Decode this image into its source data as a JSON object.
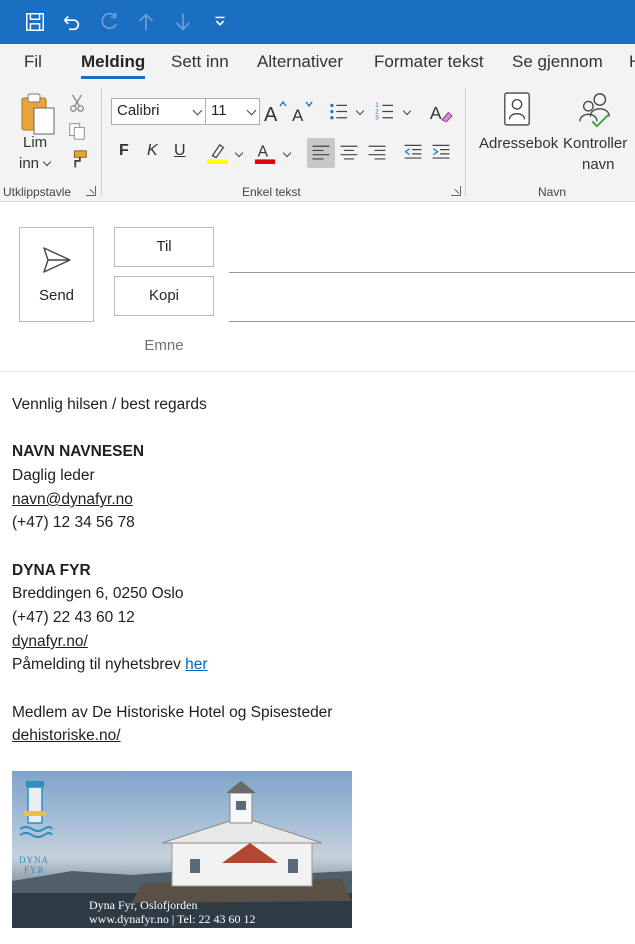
{
  "ribbon_tabs": [
    "Fil",
    "Melding",
    "Sett inn",
    "Alternativer",
    "Formater tekst",
    "Se gjennom",
    "H"
  ],
  "clipboard": {
    "paste_label_1": "Lim",
    "paste_label_2": "inn",
    "group_label": "Utklippstavle"
  },
  "basic_text": {
    "font_name": "Calibri",
    "font_size": "11",
    "bold": "F",
    "italic": "K",
    "underline": "U",
    "group_label": "Enkel tekst",
    "highlight_color": "#ffff00",
    "font_color": "#e00000"
  },
  "names": {
    "address_book": "Adressebok",
    "check_names_1": "Kontroller",
    "check_names_2": "navn",
    "group_label": "Navn"
  },
  "compose": {
    "send_label": "Send",
    "to_label": "Til",
    "cc_label": "Kopi",
    "subject_label": "Emne"
  },
  "body": {
    "greeting": "Vennlig hilsen / best regards",
    "name": "NAVN NAVNESEN",
    "title": "Daglig leder",
    "email": "navn@dynafyr.no",
    "phone": "(+47) 12 34 56 78",
    "company": "DYNA FYR",
    "address": "Breddingen 6, 0250 Oslo",
    "company_phone": "(+47) 22 43 60 12",
    "website": "dynafyr.no/",
    "newsletter_text": "Påmelding til nyhetsbrev ",
    "newsletter_link": "her",
    "member_text": "Medlem av De Historiske Hotel og Spisesteder",
    "member_link": "dehistoriske.no/"
  },
  "banner": {
    "logo_text_1": "DYNA",
    "logo_text_2": "FYR",
    "caption_1": "Dyna Fyr, Oslofjorden",
    "caption_2": "www.dynafyr.no | Tel: 22 43 60 12"
  },
  "colors": {
    "accent": "#1a6fc2",
    "link": "#0563c1"
  }
}
